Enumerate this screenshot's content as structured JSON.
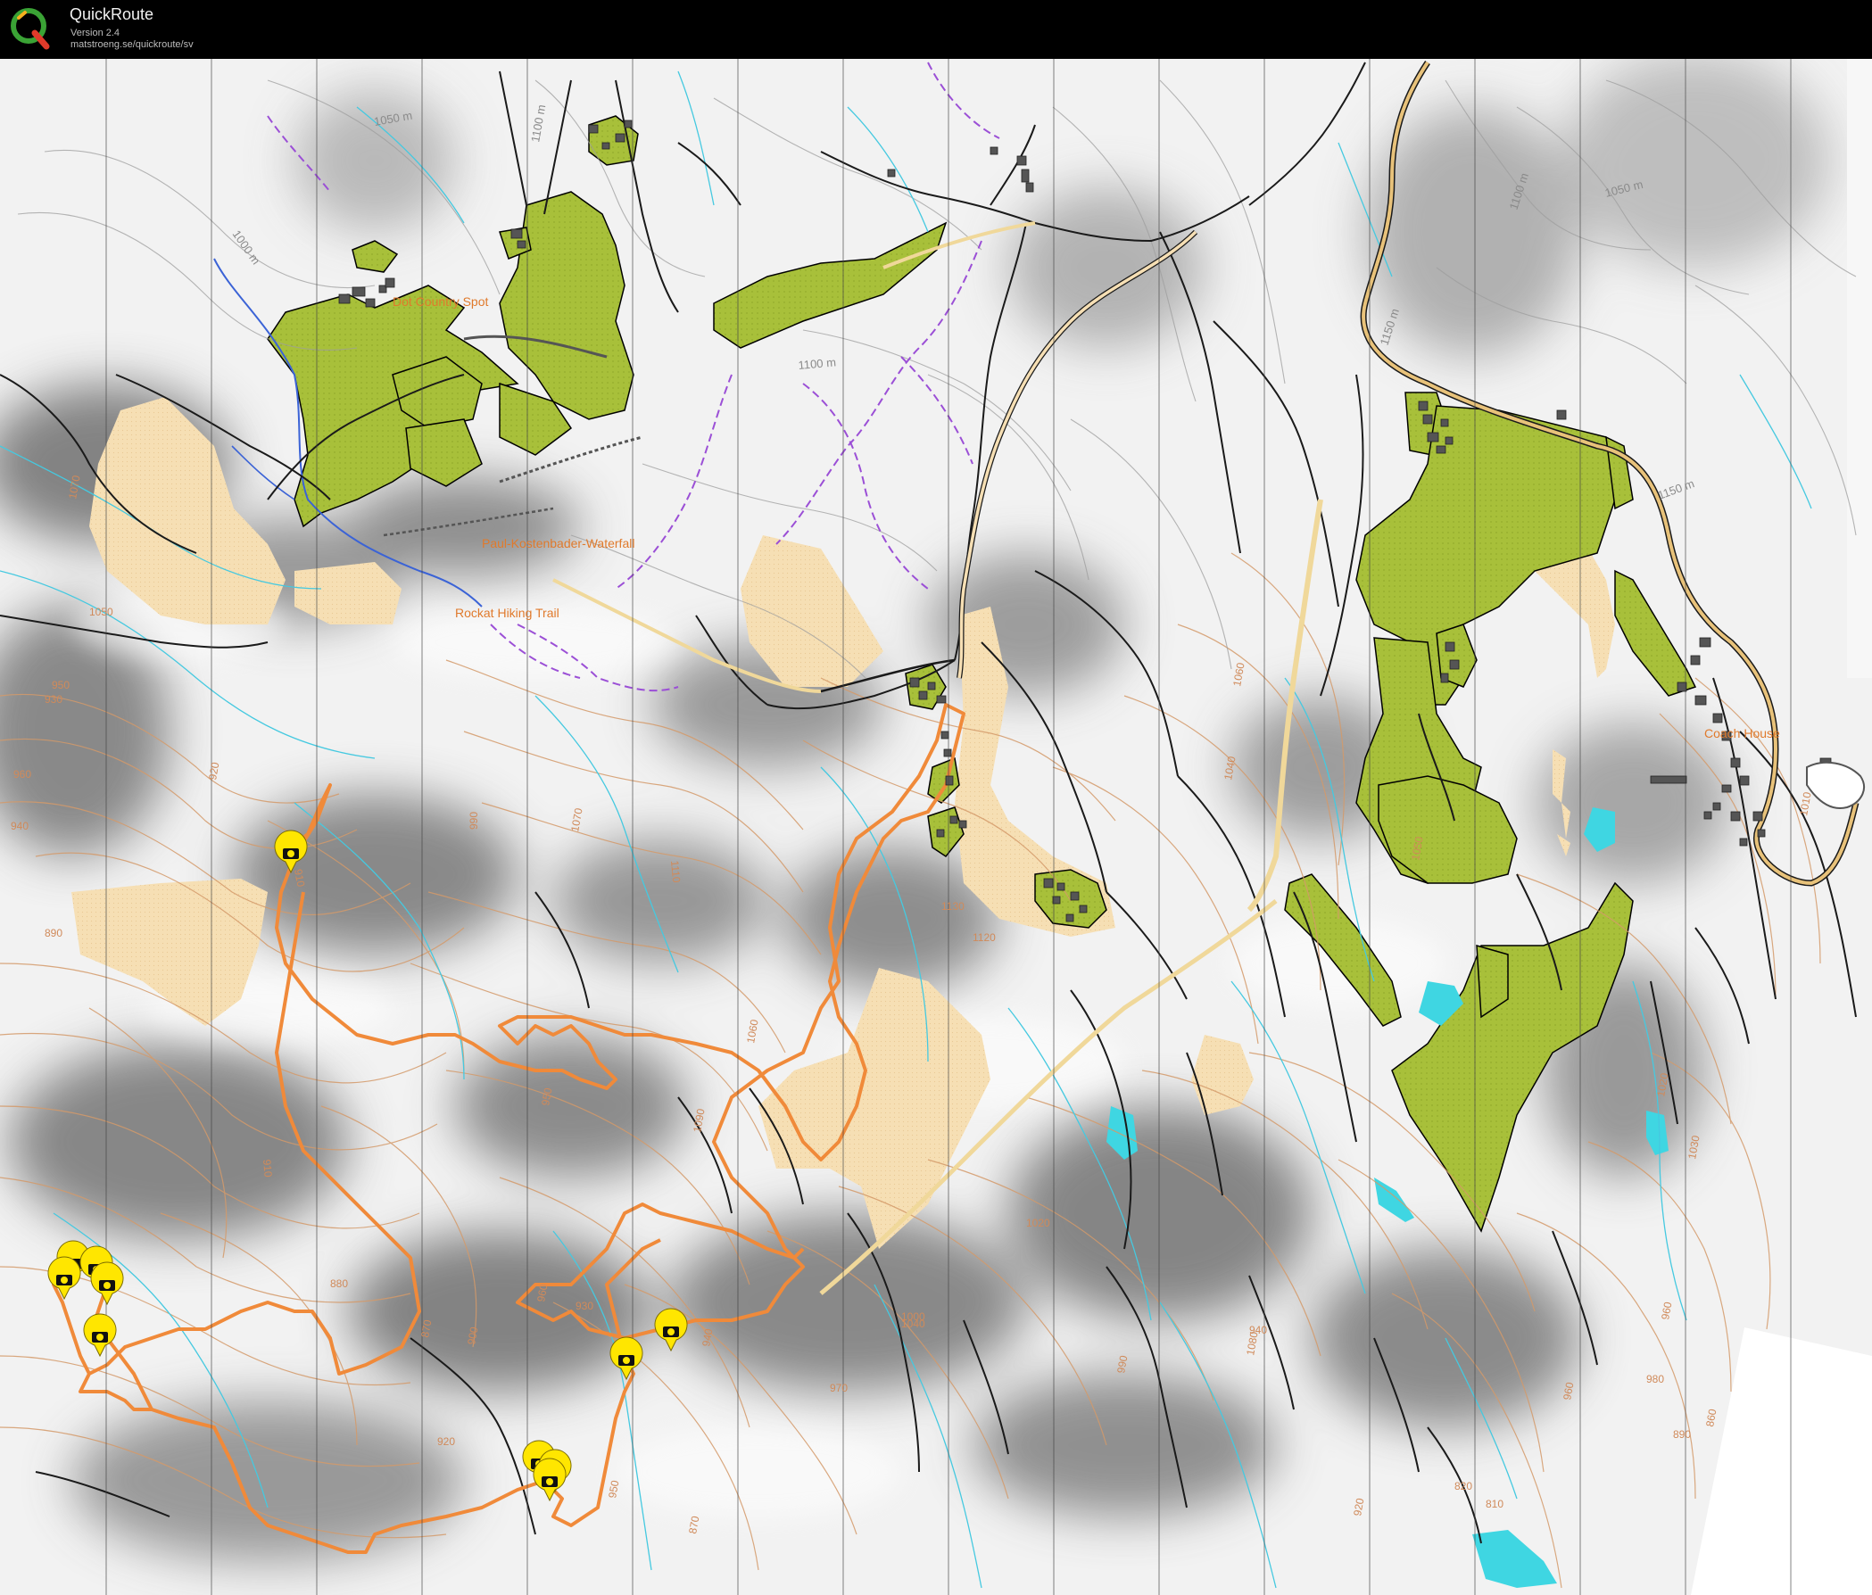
{
  "app": {
    "title": "QuickRoute",
    "version": "Version 2.4",
    "url": "matstroeng.se/quickroute/sv"
  },
  "map": {
    "place_labels": [
      "Dot Country Spot",
      "Paul-Kostenbader-Waterfall",
      "Rockat Hiking Trail",
      "Coach House"
    ],
    "contour_labels": [
      "1050 m",
      "1100 m",
      "1000 m",
      "1100 m",
      "1150 m",
      "1100 m",
      "1050 m",
      "1150 m",
      "1070",
      "1050",
      "950",
      "930",
      "960",
      "940",
      "920",
      "890",
      "910",
      "990",
      "1070",
      "1110",
      "1130",
      "1120",
      "1060",
      "1090",
      "1080",
      "1040",
      "1060",
      "1050",
      "950",
      "960",
      "910",
      "880",
      "870",
      "900",
      "930",
      "940",
      "920",
      "950",
      "970",
      "1000",
      "1020",
      "1040",
      "990",
      "940",
      "960",
      "980",
      "920",
      "870",
      "860",
      "810",
      "820",
      "890",
      "960",
      "1030",
      "1010",
      "1020"
    ]
  },
  "markers": [
    {
      "type": "camera-icon"
    },
    {
      "type": "camera-icon"
    },
    {
      "type": "camera-icon"
    },
    {
      "type": "camera-icon"
    },
    {
      "type": "camera-icon"
    },
    {
      "type": "camera-icon"
    },
    {
      "type": "camera-icon"
    },
    {
      "type": "camera-icon"
    },
    {
      "type": "camera-icon"
    },
    {
      "type": "camera-icon"
    },
    {
      "type": "camera-icon"
    }
  ],
  "colors": {
    "forest": "#a8c03a",
    "open_land": "#f6dfb4",
    "water": "#3fd6e2",
    "route": "#f08a3a",
    "contour": "#d49a6a",
    "stream": "#45c9e0",
    "path": "#1a1a1a",
    "trail": "#9b4fd6",
    "marker": "#ffe600"
  }
}
